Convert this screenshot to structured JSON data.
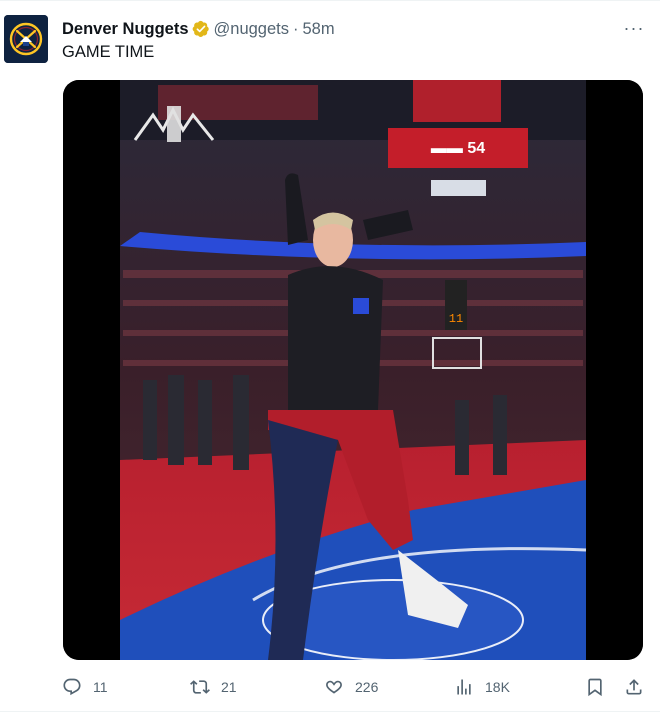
{
  "tweet": {
    "display_name": "Denver Nuggets",
    "handle": "@nuggets",
    "separator": "·",
    "time": "58m",
    "text": "GAME TIME",
    "more_label": "···"
  },
  "actions": {
    "replies": "11",
    "retweets": "21",
    "likes": "226",
    "views": "18K"
  },
  "icons": {
    "avatar": "denver-nuggets-logo",
    "verified": "gold-verified-badge",
    "reply": "speech-bubble-icon",
    "retweet": "retweet-arrows-icon",
    "like": "heart-icon",
    "views": "bar-chart-icon",
    "bookmark": "bookmark-icon",
    "share": "share-upload-icon"
  },
  "colors": {
    "text_primary": "#0f1419",
    "text_secondary": "#536471",
    "verified_gold": "#e2b719",
    "nuggets_navy": "#0e2240",
    "nuggets_gold": "#fec524",
    "court_blue": "#1d4fb6",
    "court_red": "#c8102e"
  }
}
